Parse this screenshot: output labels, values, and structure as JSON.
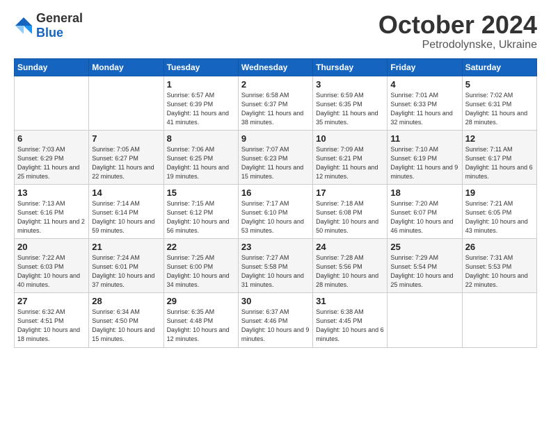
{
  "logo": {
    "general": "General",
    "blue": "Blue"
  },
  "header": {
    "month": "October 2024",
    "location": "Petrodolynske, Ukraine"
  },
  "days_of_week": [
    "Sunday",
    "Monday",
    "Tuesday",
    "Wednesday",
    "Thursday",
    "Friday",
    "Saturday"
  ],
  "weeks": [
    [
      {
        "day": "",
        "info": ""
      },
      {
        "day": "",
        "info": ""
      },
      {
        "day": "1",
        "info": "Sunrise: 6:57 AM\nSunset: 6:39 PM\nDaylight: 11 hours and 41 minutes."
      },
      {
        "day": "2",
        "info": "Sunrise: 6:58 AM\nSunset: 6:37 PM\nDaylight: 11 hours and 38 minutes."
      },
      {
        "day": "3",
        "info": "Sunrise: 6:59 AM\nSunset: 6:35 PM\nDaylight: 11 hours and 35 minutes."
      },
      {
        "day": "4",
        "info": "Sunrise: 7:01 AM\nSunset: 6:33 PM\nDaylight: 11 hours and 32 minutes."
      },
      {
        "day": "5",
        "info": "Sunrise: 7:02 AM\nSunset: 6:31 PM\nDaylight: 11 hours and 28 minutes."
      }
    ],
    [
      {
        "day": "6",
        "info": "Sunrise: 7:03 AM\nSunset: 6:29 PM\nDaylight: 11 hours and 25 minutes."
      },
      {
        "day": "7",
        "info": "Sunrise: 7:05 AM\nSunset: 6:27 PM\nDaylight: 11 hours and 22 minutes."
      },
      {
        "day": "8",
        "info": "Sunrise: 7:06 AM\nSunset: 6:25 PM\nDaylight: 11 hours and 19 minutes."
      },
      {
        "day": "9",
        "info": "Sunrise: 7:07 AM\nSunset: 6:23 PM\nDaylight: 11 hours and 15 minutes."
      },
      {
        "day": "10",
        "info": "Sunrise: 7:09 AM\nSunset: 6:21 PM\nDaylight: 11 hours and 12 minutes."
      },
      {
        "day": "11",
        "info": "Sunrise: 7:10 AM\nSunset: 6:19 PM\nDaylight: 11 hours and 9 minutes."
      },
      {
        "day": "12",
        "info": "Sunrise: 7:11 AM\nSunset: 6:17 PM\nDaylight: 11 hours and 6 minutes."
      }
    ],
    [
      {
        "day": "13",
        "info": "Sunrise: 7:13 AM\nSunset: 6:16 PM\nDaylight: 11 hours and 2 minutes."
      },
      {
        "day": "14",
        "info": "Sunrise: 7:14 AM\nSunset: 6:14 PM\nDaylight: 10 hours and 59 minutes."
      },
      {
        "day": "15",
        "info": "Sunrise: 7:15 AM\nSunset: 6:12 PM\nDaylight: 10 hours and 56 minutes."
      },
      {
        "day": "16",
        "info": "Sunrise: 7:17 AM\nSunset: 6:10 PM\nDaylight: 10 hours and 53 minutes."
      },
      {
        "day": "17",
        "info": "Sunrise: 7:18 AM\nSunset: 6:08 PM\nDaylight: 10 hours and 50 minutes."
      },
      {
        "day": "18",
        "info": "Sunrise: 7:20 AM\nSunset: 6:07 PM\nDaylight: 10 hours and 46 minutes."
      },
      {
        "day": "19",
        "info": "Sunrise: 7:21 AM\nSunset: 6:05 PM\nDaylight: 10 hours and 43 minutes."
      }
    ],
    [
      {
        "day": "20",
        "info": "Sunrise: 7:22 AM\nSunset: 6:03 PM\nDaylight: 10 hours and 40 minutes."
      },
      {
        "day": "21",
        "info": "Sunrise: 7:24 AM\nSunset: 6:01 PM\nDaylight: 10 hours and 37 minutes."
      },
      {
        "day": "22",
        "info": "Sunrise: 7:25 AM\nSunset: 6:00 PM\nDaylight: 10 hours and 34 minutes."
      },
      {
        "day": "23",
        "info": "Sunrise: 7:27 AM\nSunset: 5:58 PM\nDaylight: 10 hours and 31 minutes."
      },
      {
        "day": "24",
        "info": "Sunrise: 7:28 AM\nSunset: 5:56 PM\nDaylight: 10 hours and 28 minutes."
      },
      {
        "day": "25",
        "info": "Sunrise: 7:29 AM\nSunset: 5:54 PM\nDaylight: 10 hours and 25 minutes."
      },
      {
        "day": "26",
        "info": "Sunrise: 7:31 AM\nSunset: 5:53 PM\nDaylight: 10 hours and 22 minutes."
      }
    ],
    [
      {
        "day": "27",
        "info": "Sunrise: 6:32 AM\nSunset: 4:51 PM\nDaylight: 10 hours and 18 minutes."
      },
      {
        "day": "28",
        "info": "Sunrise: 6:34 AM\nSunset: 4:50 PM\nDaylight: 10 hours and 15 minutes."
      },
      {
        "day": "29",
        "info": "Sunrise: 6:35 AM\nSunset: 4:48 PM\nDaylight: 10 hours and 12 minutes."
      },
      {
        "day": "30",
        "info": "Sunrise: 6:37 AM\nSunset: 4:46 PM\nDaylight: 10 hours and 9 minutes."
      },
      {
        "day": "31",
        "info": "Sunrise: 6:38 AM\nSunset: 4:45 PM\nDaylight: 10 hours and 6 minutes."
      },
      {
        "day": "",
        "info": ""
      },
      {
        "day": "",
        "info": ""
      }
    ]
  ]
}
